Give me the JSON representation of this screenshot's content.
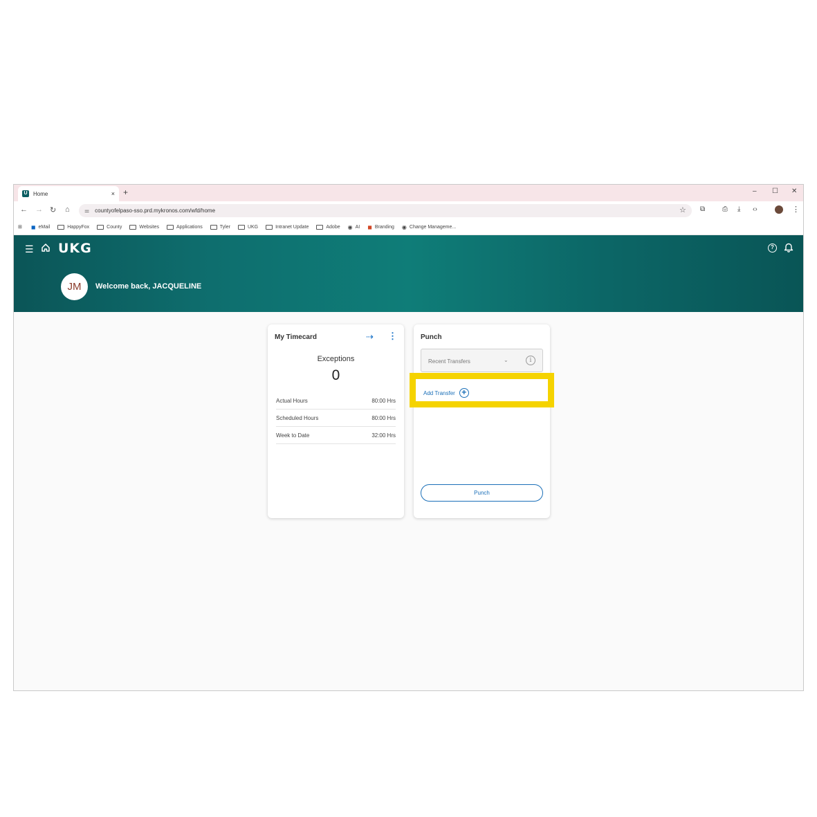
{
  "browser": {
    "tab_title": "Home",
    "tab_close": "×",
    "new_tab": "+",
    "window_controls": {
      "minimize": "–",
      "maximize": "☐",
      "close": "✕"
    },
    "url": "countyofelpaso-sso.prd.mykronos.com/wfd/home",
    "bookmarks": [
      {
        "label": "eMail",
        "icon": "outlook-icon"
      },
      {
        "label": "HappyFox",
        "icon": "folder-icon"
      },
      {
        "label": "County",
        "icon": "folder-icon"
      },
      {
        "label": "Websites",
        "icon": "folder-icon"
      },
      {
        "label": "Applications",
        "icon": "folder-icon"
      },
      {
        "label": "Tyler",
        "icon": "folder-icon"
      },
      {
        "label": "UKG",
        "icon": "folder-icon"
      },
      {
        "label": "Intranet Update",
        "icon": "folder-icon"
      },
      {
        "label": "Adobe",
        "icon": "folder-icon"
      },
      {
        "label": "AI",
        "icon": "globe-icon"
      },
      {
        "label": "Branding",
        "icon": "office-icon"
      },
      {
        "label": "Change Manageme...",
        "icon": "globe-icon"
      }
    ]
  },
  "header": {
    "logo": "UKG",
    "avatar_initials": "JM",
    "welcome": "Welcome back, JACQUELINE"
  },
  "timecard": {
    "title": "My Timecard",
    "exceptions_label": "Exceptions",
    "exceptions_count": "0",
    "rows": [
      {
        "label": "Actual Hours",
        "value": "80:00 Hrs"
      },
      {
        "label": "Scheduled Hours",
        "value": "80:00 Hrs"
      },
      {
        "label": "Week to Date",
        "value": "32:00 Hrs"
      }
    ]
  },
  "punch": {
    "title": "Punch",
    "recent_transfers_placeholder": "Recent Transfers",
    "add_transfer_label": "Add Transfer",
    "punch_button_label": "Punch"
  },
  "colors": {
    "brand_teal": "#0b5e62",
    "highlight_yellow": "#f5d300",
    "link_blue": "#1a6fb8"
  }
}
